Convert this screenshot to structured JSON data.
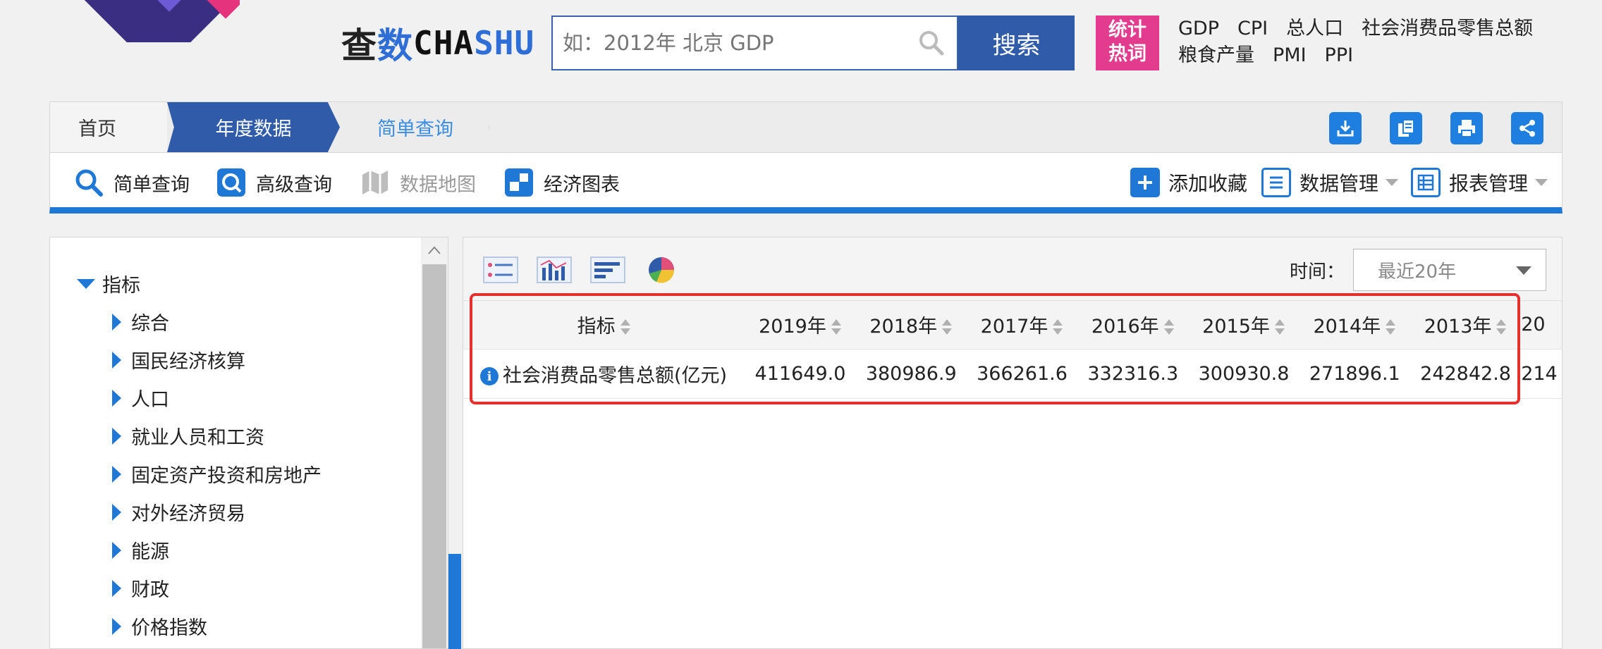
{
  "brand": {
    "part1": "查",
    "part2": "数",
    "part3": "CHA",
    "part4": "SHU"
  },
  "search": {
    "placeholder": "如：2012年 北京 GDP",
    "button_label": "搜索"
  },
  "hot": {
    "badge_line1": "统计",
    "badge_line2": "热词",
    "links": [
      "GDP",
      "CPI",
      "总人口",
      "社会消费品零售总额",
      "粮食产量",
      "PMI",
      "PPI"
    ]
  },
  "breadcrumb": {
    "home": "首页",
    "year_data": "年度数据",
    "simple_query": "简单查询"
  },
  "toolbar_icons": [
    "download-icon",
    "copy-icon",
    "print-icon",
    "share-icon"
  ],
  "nav": {
    "simple_query": "简单查询",
    "advanced_query": "高级查询",
    "data_map": "数据地图",
    "economic_chart": "经济图表",
    "add_favorite": "添加收藏",
    "data_manage": "数据管理",
    "report_manage": "报表管理"
  },
  "tree": {
    "root": "指标",
    "items": [
      "综合",
      "国民经济核算",
      "人口",
      "就业人员和工资",
      "固定资产投资和房地产",
      "对外经济贸易",
      "能源",
      "财政",
      "价格指数"
    ]
  },
  "filter": {
    "time_label": "时间：",
    "time_value": "最近20年"
  },
  "table": {
    "indicator_header": "指标",
    "years": [
      "2019年",
      "2018年",
      "2017年",
      "2016年",
      "2015年",
      "2014年",
      "2013年",
      "20"
    ],
    "row_label": "社会消费品零售总额(亿元)",
    "values": [
      "411649.0",
      "380986.9",
      "366261.6",
      "332316.3",
      "300930.8",
      "271896.1",
      "242842.8",
      "214"
    ]
  },
  "colors": {
    "primary_blue": "#2f5ba9",
    "accent_blue": "#1f77d6",
    "hot_pink": "#e33c8f",
    "highlight_red": "#e53030"
  }
}
